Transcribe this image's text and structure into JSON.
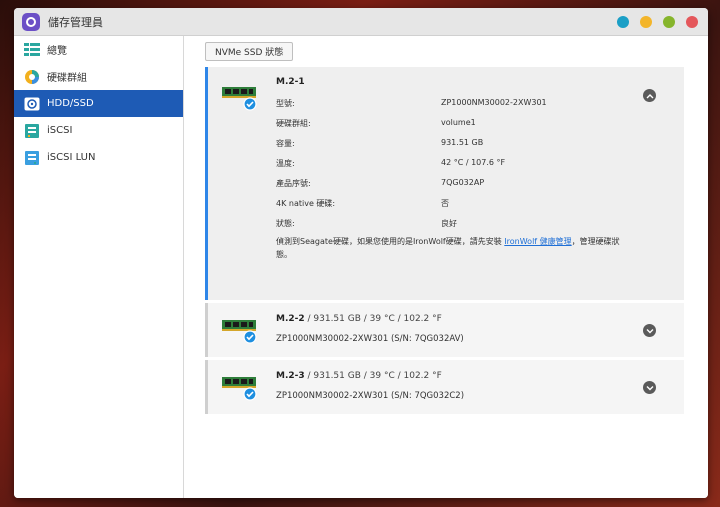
{
  "app": {
    "title": "儲存管理員"
  },
  "window_controls": [
    {
      "name": "info",
      "color": "#1b9fc6"
    },
    {
      "name": "minimize",
      "color": "#f3b52a"
    },
    {
      "name": "maximize",
      "color": "#86b52c"
    },
    {
      "name": "close",
      "color": "#e4575b"
    }
  ],
  "sidebar": {
    "items": [
      {
        "label": "總覽",
        "icon": "overview-icon"
      },
      {
        "label": "硬碟群組",
        "icon": "disk-group-icon"
      },
      {
        "label": "HDD/SSD",
        "icon": "hdd-icon",
        "active": true
      },
      {
        "label": "iSCSI",
        "icon": "iscsi-icon"
      },
      {
        "label": "iSCSI LUN",
        "icon": "iscsi-lun-icon"
      }
    ]
  },
  "tab": {
    "label": "NVMe SSD 狀態"
  },
  "drives": [
    {
      "name": "M.2-1",
      "expanded": true,
      "details": [
        {
          "label": "型號:",
          "value": "ZP1000NM30002-2XW301"
        },
        {
          "label": "硬碟群組:",
          "value": "volume1"
        },
        {
          "label": "容量:",
          "value": "931.51 GB"
        },
        {
          "label": "溫度:",
          "value": "42 °C / 107.6 °F"
        },
        {
          "label": "產品序號:",
          "value": "7QG032AP"
        },
        {
          "label": "4K native 硬碟:",
          "value": "否"
        },
        {
          "label": "狀態:",
          "value": "良好"
        }
      ],
      "note_before": "偵測到Seagate硬碟，如果您使用的是IronWolf硬碟，請先安裝 ",
      "note_link": "IronWolf 健康管理",
      "note_after": "，管理硬碟狀態。"
    },
    {
      "name": "M.2-2",
      "meta": " / 931.51 GB / 39 °C / 102.2 °F",
      "sub": "ZP1000NM30002-2XW301 (S/N: 7QG032AV)"
    },
    {
      "name": "M.2-3",
      "meta": " / 931.51 GB / 39 °C / 102.2 °F",
      "sub": "ZP1000NM30002-2XW301 (S/N: 7QG032C2)"
    }
  ]
}
